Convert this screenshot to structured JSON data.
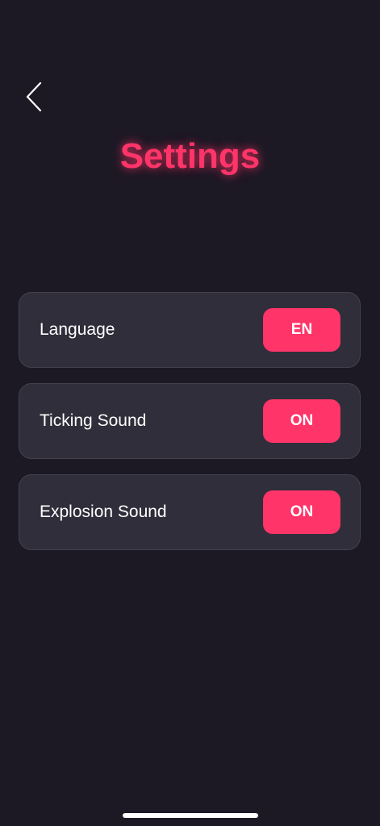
{
  "header": {
    "title": "Settings",
    "back_icon": "chevron-left-icon"
  },
  "settings": [
    {
      "label": "Language",
      "value": "EN"
    },
    {
      "label": "Ticking Sound",
      "value": "ON"
    },
    {
      "label": "Explosion Sound",
      "value": "ON"
    }
  ],
  "colors": {
    "background": "#1c1925",
    "accent": "#ff3468",
    "card": "#302e3a",
    "text": "#ffffff"
  }
}
